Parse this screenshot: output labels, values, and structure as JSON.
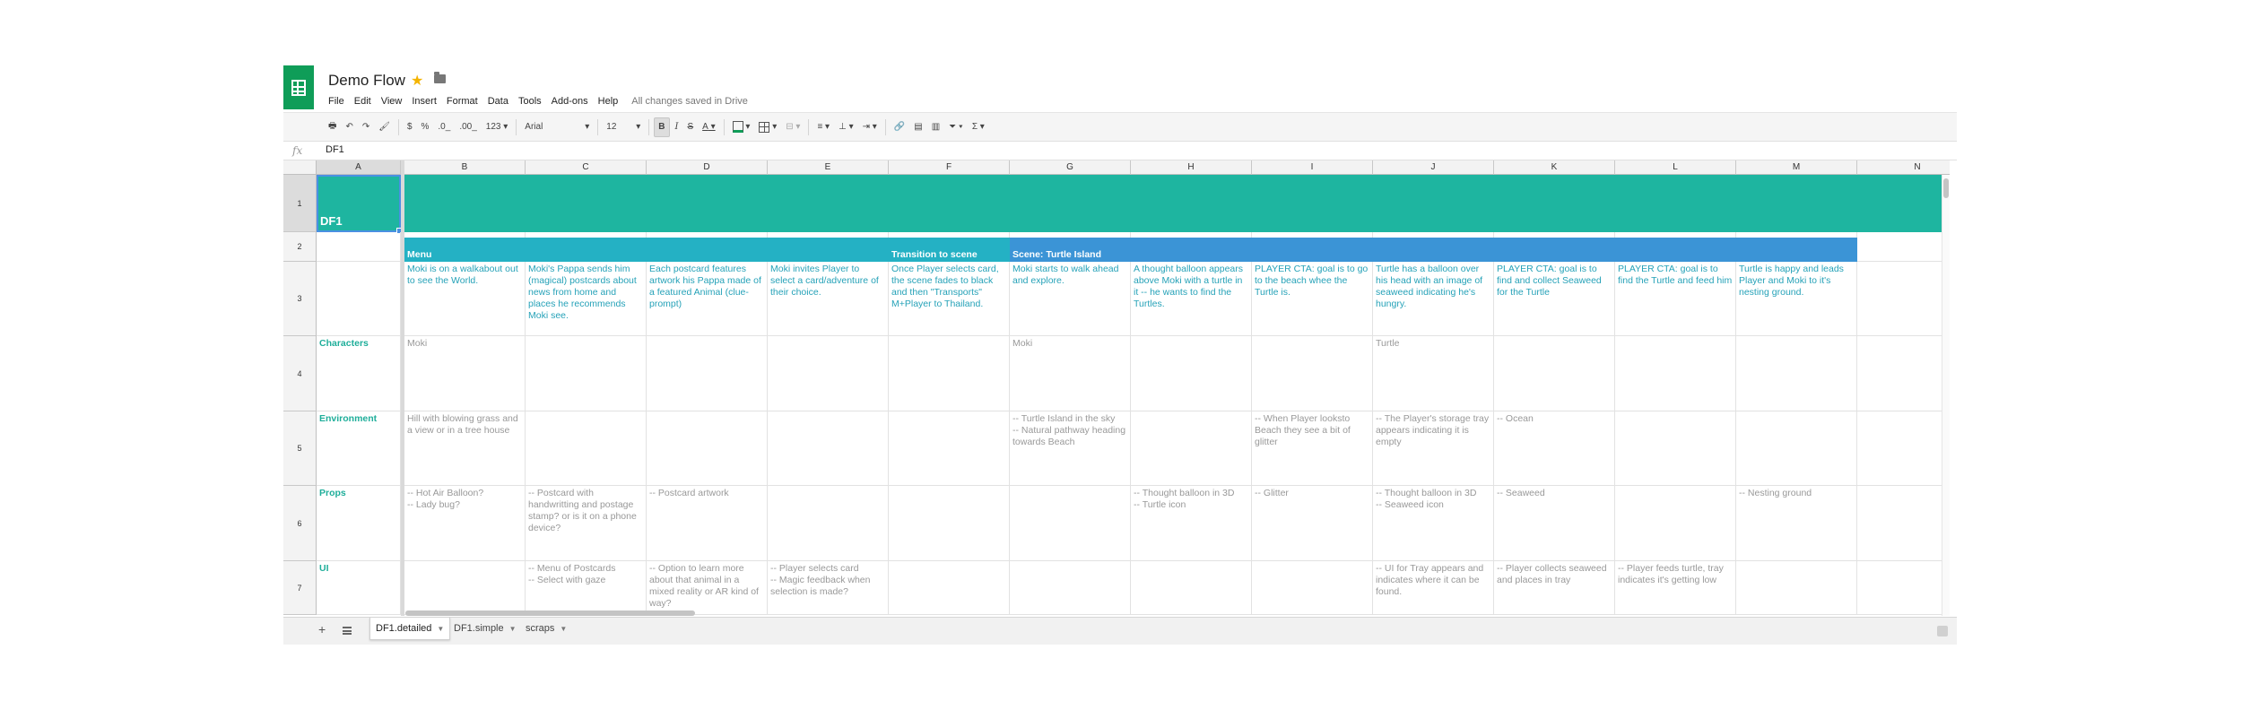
{
  "document": {
    "title": "Demo Flow",
    "star_icon": "star-icon",
    "folder_icon": "folder-icon"
  },
  "menu": {
    "items": [
      "File",
      "Edit",
      "View",
      "Insert",
      "Format",
      "Data",
      "Tools",
      "Add-ons",
      "Help"
    ],
    "saved_status": "All changes saved in Drive"
  },
  "toolbar": {
    "currency": "$",
    "percent": "%",
    "dec_decrease": ".0_",
    "dec_increase": ".00_",
    "format_more": "123",
    "font": "Arial",
    "font_size": "12",
    "bold": "B",
    "italic": "I",
    "strike": "S",
    "text_color": "A",
    "sigma": "Σ"
  },
  "formula_bar": {
    "fx": "fx",
    "value": "DF1"
  },
  "columns": [
    "A",
    "B",
    "C",
    "D",
    "E",
    "F",
    "G",
    "H",
    "I",
    "J",
    "K",
    "L",
    "M",
    "N"
  ],
  "rows": [
    "1",
    "2",
    "3",
    "4",
    "5",
    "6",
    "7"
  ],
  "sheet": {
    "a1": "DF1",
    "sections": {
      "menu": "Menu",
      "transition": "Transition to scene",
      "scene": "Scene: Turtle Island"
    },
    "row_labels": {
      "characters": "Characters",
      "environment": "Environment",
      "props": "Props",
      "ui": "UI"
    },
    "row3": {
      "B": "Moki is on a walkabout out to see the World.",
      "C": "Moki's Pappa sends him (magical) postcards about news from home and places he recommends Moki see.",
      "D": "Each postcard features artwork his Pappa made of a featured Animal (clue-prompt)",
      "E": "Moki invites Player to select a card/adventure of their choice.",
      "F": "Once Player selects card, the scene fades to black and then \"Transports\" M+Player to Thailand.",
      "G": "Moki starts to walk ahead and explore.",
      "H": "A thought balloon appears above Moki with a turtle in it -- he wants to find the Turtles.",
      "I": "PLAYER CTA: goal is to go to the beach whee the Turtle is.",
      "J": "Turtle has a balloon over his head with an image of seaweed indicating he's hungry.",
      "K": "PLAYER CTA: goal is to find and collect Seaweed for the Turtle",
      "L": "PLAYER CTA: goal is to find the Turtle and feed him",
      "M": "Turtle is happy and leads Player and Moki to it's nesting ground."
    },
    "row4": {
      "B": "Moki",
      "G": "Moki",
      "J": "Turtle"
    },
    "row5": {
      "B": "Hill with blowing grass and a view or in a tree house",
      "G": "-- Turtle Island in the sky\n-- Natural pathway heading towards Beach",
      "I": "-- When Player looksto Beach they see a bit of glitter",
      "J": "-- The Player's storage tray appears indicating it is empty",
      "K": "-- Ocean"
    },
    "row6": {
      "B": "-- Hot Air Balloon?\n-- Lady bug?",
      "C": "-- Postcard with handwritting and postage stamp? or is it on a phone device?",
      "D": "-- Postcard artwork",
      "H": "-- Thought balloon in 3D\n-- Turtle icon",
      "I": "-- Glitter",
      "J": "-- Thought balloon in 3D\n-- Seaweed icon",
      "K": "-- Seaweed",
      "M": "-- Nesting ground"
    },
    "row7": {
      "C": "-- Menu of Postcards\n-- Select with gaze",
      "D": "-- Option to learn more about that animal in a mixed reality or AR kind of way?",
      "E": "-- Player selects card\n-- Magic feedback when selection is made?",
      "J": "-- UI for Tray appears and indicates where it can be found.",
      "K": "-- Player collects seaweed and places in tray",
      "L": "-- Player feeds turtle, tray indicates it's getting low"
    }
  },
  "tabs": [
    {
      "label": "DF1.detailed",
      "active": true
    },
    {
      "label": "DF1.simple",
      "active": false
    },
    {
      "label": "scraps",
      "active": false
    }
  ],
  "colors": {
    "teal": "#1eb5a0",
    "turquoise": "#24b1c4",
    "blue": "#3b94d6",
    "desc_text": "#26a2b8",
    "label_text": "#1fae9a"
  }
}
